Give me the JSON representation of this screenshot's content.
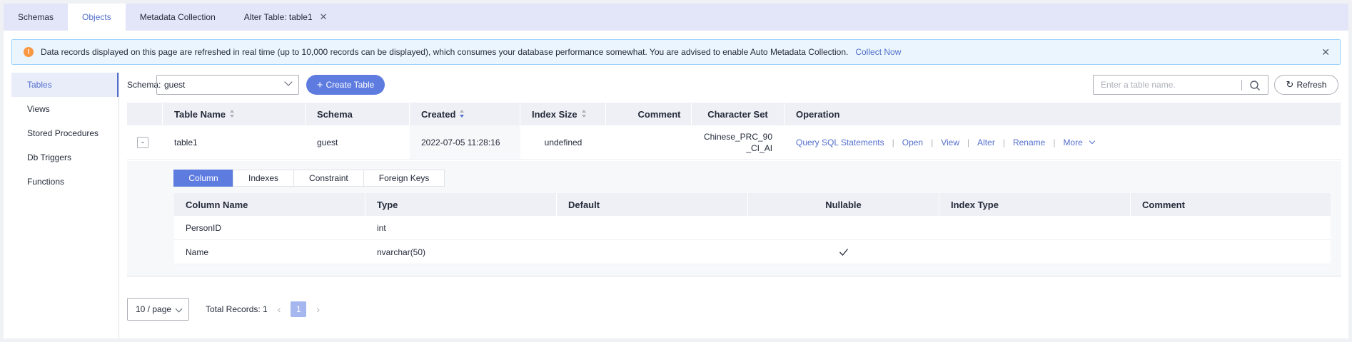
{
  "top_tabs": [
    {
      "label": "Schemas"
    },
    {
      "label": "Objects"
    },
    {
      "label": "Metadata Collection"
    },
    {
      "label": "Alter Table: table1"
    }
  ],
  "notice": {
    "text": "Data records displayed on this page are refreshed in real time (up to 10,000 records can be displayed), which consumes your database performance somewhat. You are advised to enable Auto Metadata Collection.",
    "link": "Collect Now"
  },
  "sidebar": {
    "items": [
      {
        "label": "Tables"
      },
      {
        "label": "Views"
      },
      {
        "label": "Stored Procedures"
      },
      {
        "label": "Db Triggers"
      },
      {
        "label": "Functions"
      }
    ]
  },
  "toolbar": {
    "schema_label": "Schema:",
    "schema_value": "guest",
    "create_label": "Create Table",
    "search_placeholder": "Enter a table name.",
    "refresh_label": "Refresh"
  },
  "table": {
    "headers": {
      "name": "Table Name",
      "schema": "Schema",
      "created": "Created",
      "index_size": "Index Size",
      "comment": "Comment",
      "charset": "Character Set",
      "operation": "Operation"
    },
    "rows": [
      {
        "expand": "-",
        "name": "table1",
        "schema": "guest",
        "created": "2022-07-05 11:28:16",
        "index_size": "undefined",
        "comment": "",
        "charset_line1": "Chinese_PRC_90",
        "charset_line2": "_CI_AI"
      }
    ],
    "operations": [
      "Query SQL Statements",
      "Open",
      "View",
      "Alter",
      "Rename",
      "More"
    ]
  },
  "detail": {
    "tabs": [
      "Column",
      "Indexes",
      "Constraint",
      "Foreign Keys"
    ],
    "headers": [
      "Column Name",
      "Type",
      "Default",
      "Nullable",
      "Index Type",
      "Comment"
    ],
    "rows": [
      {
        "column": "PersonID",
        "type": "int",
        "default": "",
        "nullable": false,
        "index_type": "",
        "comment": ""
      },
      {
        "column": "Name",
        "type": "nvarchar(50)",
        "default": "",
        "nullable": true,
        "index_type": "",
        "comment": ""
      }
    ]
  },
  "pagination": {
    "page_size": "10 / page",
    "total": "Total Records: 1",
    "current_page": "1"
  },
  "colors": {
    "accent": "#5e7ce0",
    "link": "#526ecc",
    "warning": "#fa9841"
  }
}
